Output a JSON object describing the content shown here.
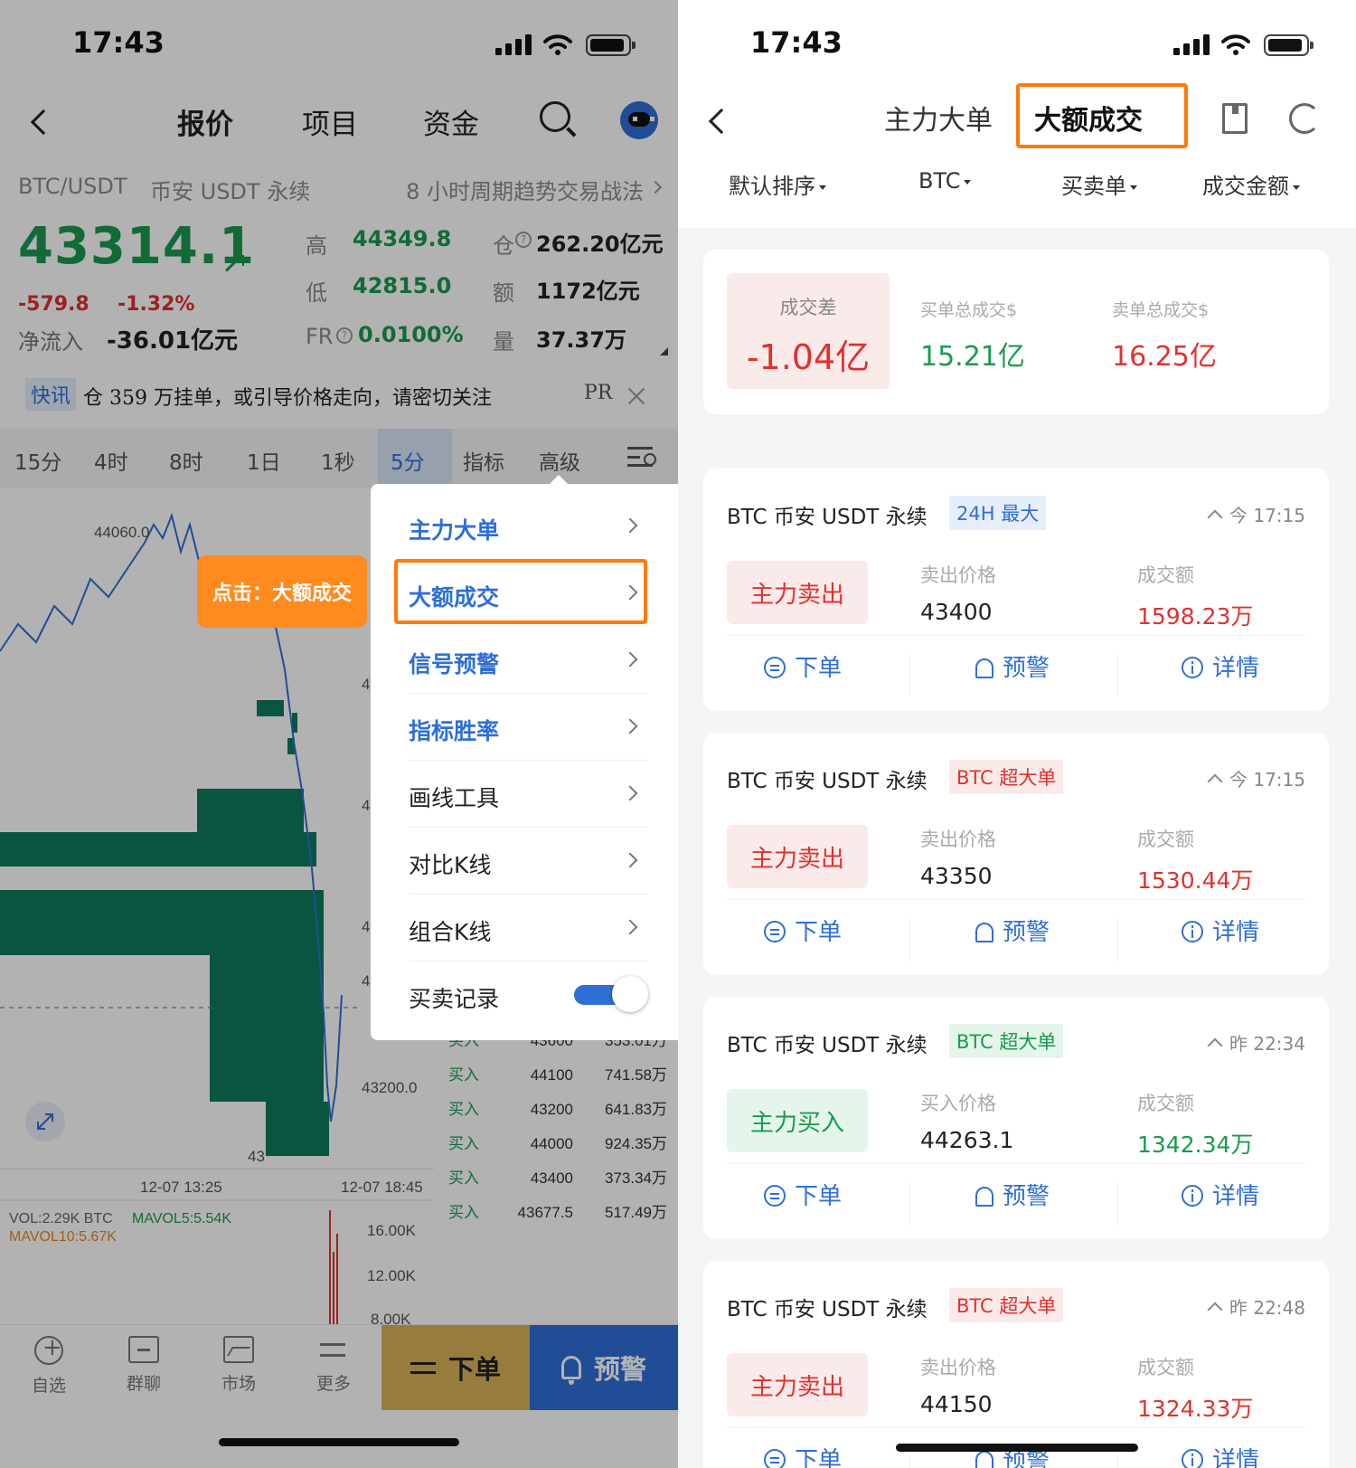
{
  "status_bar": {
    "time": "17:43"
  },
  "left": {
    "nav": {
      "tabs": [
        "报价",
        "项目",
        "资金"
      ]
    },
    "pair": {
      "symbol": "BTC/USDT",
      "exchange": "币安 USDT 永续",
      "strategy": "8 小时周期趋势交易战法"
    },
    "quote": {
      "price": "43314.1",
      "change": "-579.8",
      "change_pct": "-1.32%",
      "netflow_label": "净流入",
      "netflow": "-36.01亿元"
    },
    "stats": [
      {
        "label": "高",
        "value": "44349.8"
      },
      {
        "label": "低",
        "value": "42815.0"
      },
      {
        "label": "FR",
        "value": "0.0100%"
      },
      {
        "label": "仓",
        "value": "262.20亿元"
      },
      {
        "label": "额",
        "value": "1172亿元"
      },
      {
        "label": "量",
        "value": "37.37万"
      }
    ],
    "news": {
      "tag": "快讯",
      "text": "仓 359 万挂单，或引导价格走向，请密切关注",
      "pr": "PR"
    },
    "timeframes": [
      "15分",
      "4时",
      "8时",
      "1日",
      "1秒",
      "5分",
      "指标",
      "高级"
    ],
    "active_timeframe": "5分",
    "chart": {
      "price_labels": [
        "44060.0",
        "43200.0",
        "43"
      ],
      "axis_partial": [
        "4",
        "4",
        "4",
        "4"
      ],
      "time_labels": [
        "12-07 13:25",
        "12-07 18:45"
      ],
      "vol_text": "VOL:2.29K BTC",
      "mavol5": "MAVOL5:5.54K",
      "mavol10": "MAVOL10:5.67K",
      "vol_axis": [
        "16.00K",
        "12.00K",
        "8.00K"
      ],
      "colors": {
        "bar": "#0d7a5c",
        "line": "#2f6fd6"
      }
    },
    "trades": [
      {
        "side": "买入",
        "price": "43600",
        "amount": "353.01万"
      },
      {
        "side": "买入",
        "price": "44100",
        "amount": "741.58万"
      },
      {
        "side": "买入",
        "price": "43200",
        "amount": "641.83万"
      },
      {
        "side": "买入",
        "price": "44000",
        "amount": "924.35万"
      },
      {
        "side": "买入",
        "price": "43400",
        "amount": "373.34万"
      },
      {
        "side": "买入",
        "price": "43677.5",
        "amount": "517.49万"
      }
    ],
    "menu": {
      "items": [
        "主力大单",
        "大额成交",
        "信号预警",
        "指标胜率",
        "画线工具",
        "对比K线",
        "组合K线",
        "买卖记录"
      ],
      "callout": "点击：大额成交"
    },
    "bottom": {
      "items": [
        "自选",
        "群聊",
        "市场",
        "更多"
      ],
      "order_btn": "下单",
      "alert_btn": "预警"
    }
  },
  "right": {
    "tabs": [
      "主力大单",
      "大额成交"
    ],
    "filters": [
      "默认排序",
      "BTC",
      "买卖单",
      "成交金额"
    ],
    "summary": {
      "diff_label": "成交差",
      "diff_value": "-1.04亿",
      "buy_label": "买单总成交$",
      "buy_value": "15.21亿",
      "sell_label": "卖单总成交$",
      "sell_value": "16.25亿"
    },
    "cards": [
      {
        "title": "BTC 币安 USDT 永续",
        "badge": "24H 最大",
        "badge_color": "blue",
        "time": "今 17:15",
        "side": "主力卖出",
        "side_type": "sell",
        "price_label": "卖出价格",
        "price": "43400",
        "amount_label": "成交额",
        "amount": "1598.23万"
      },
      {
        "title": "BTC 币安 USDT 永续",
        "badge": "BTC 超大单",
        "badge_color": "red",
        "time": "今 17:15",
        "side": "主力卖出",
        "side_type": "sell",
        "price_label": "卖出价格",
        "price": "43350",
        "amount_label": "成交额",
        "amount": "1530.44万"
      },
      {
        "title": "BTC 币安 USDT 永续",
        "badge": "BTC 超大单",
        "badge_color": "green",
        "time": "昨 22:34",
        "side": "主力买入",
        "side_type": "buy",
        "price_label": "买入价格",
        "price": "44263.1",
        "amount_label": "成交额",
        "amount": "1342.34万"
      },
      {
        "title": "BTC 币安 USDT 永续",
        "badge": "BTC 超大单",
        "badge_color": "red",
        "time": "昨 22:48",
        "side": "主力卖出",
        "side_type": "sell",
        "price_label": "卖出价格",
        "price": "44150",
        "amount_label": "成交额",
        "amount": "1324.33万"
      }
    ],
    "actions": [
      "下单",
      "预警",
      "详情"
    ]
  }
}
